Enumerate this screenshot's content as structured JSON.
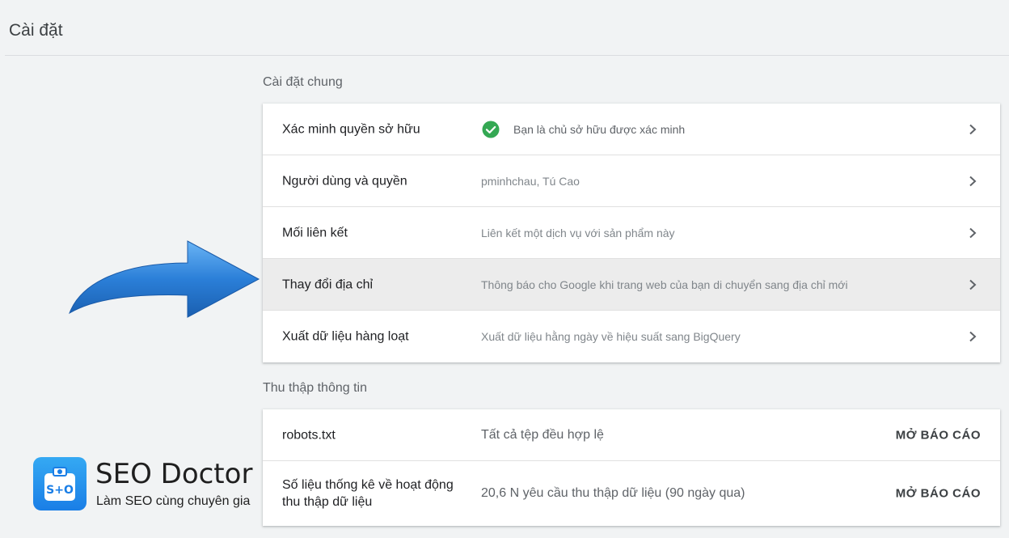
{
  "header": {
    "title": "Cài đặt"
  },
  "general": {
    "label": "Cài đặt chung",
    "rows": [
      {
        "title": "Xác minh quyền sở hữu",
        "desc": "Bạn là chủ sở hữu được xác minh"
      },
      {
        "title": "Người dùng và quyền",
        "desc": "pminhchau, Tú Cao"
      },
      {
        "title": "Mối liên kết",
        "desc": "Liên kết một dịch vụ với sản phẩm này"
      },
      {
        "title": "Thay đổi địa chỉ",
        "desc": "Thông báo cho Google khi trang web của bạn di chuyển sang địa chỉ mới"
      },
      {
        "title": "Xuất dữ liệu hàng loạt",
        "desc": "Xuất dữ liệu hằng ngày về hiệu suất sang BigQuery"
      }
    ]
  },
  "crawl": {
    "label": "Thu thập thông tin",
    "rows": [
      {
        "title": "robots.txt",
        "desc": "Tất cả tệp đều hợp lệ",
        "action": "MỞ BÁO CÁO"
      },
      {
        "title": "Số liệu thống kê về hoạt động thu thập dữ liệu",
        "desc": "20,6 N yêu cầu thu thập dữ liệu (90 ngày qua)",
        "action": "MỞ BÁO CÁO"
      }
    ]
  },
  "watermark": {
    "name": "SEO Doctor",
    "tagline": "Làm SEO cùng chuyên gia"
  },
  "icons": {
    "verified": "check-circle-icon",
    "row_nav": "chevron-right-icon",
    "overlay": "arrow-right-icon",
    "logo": "seo-doctor-logo"
  },
  "colors": {
    "verified_green": "#34a853",
    "arrow_blue": "#2b7fd8",
    "highlight_row": "#ececec"
  }
}
